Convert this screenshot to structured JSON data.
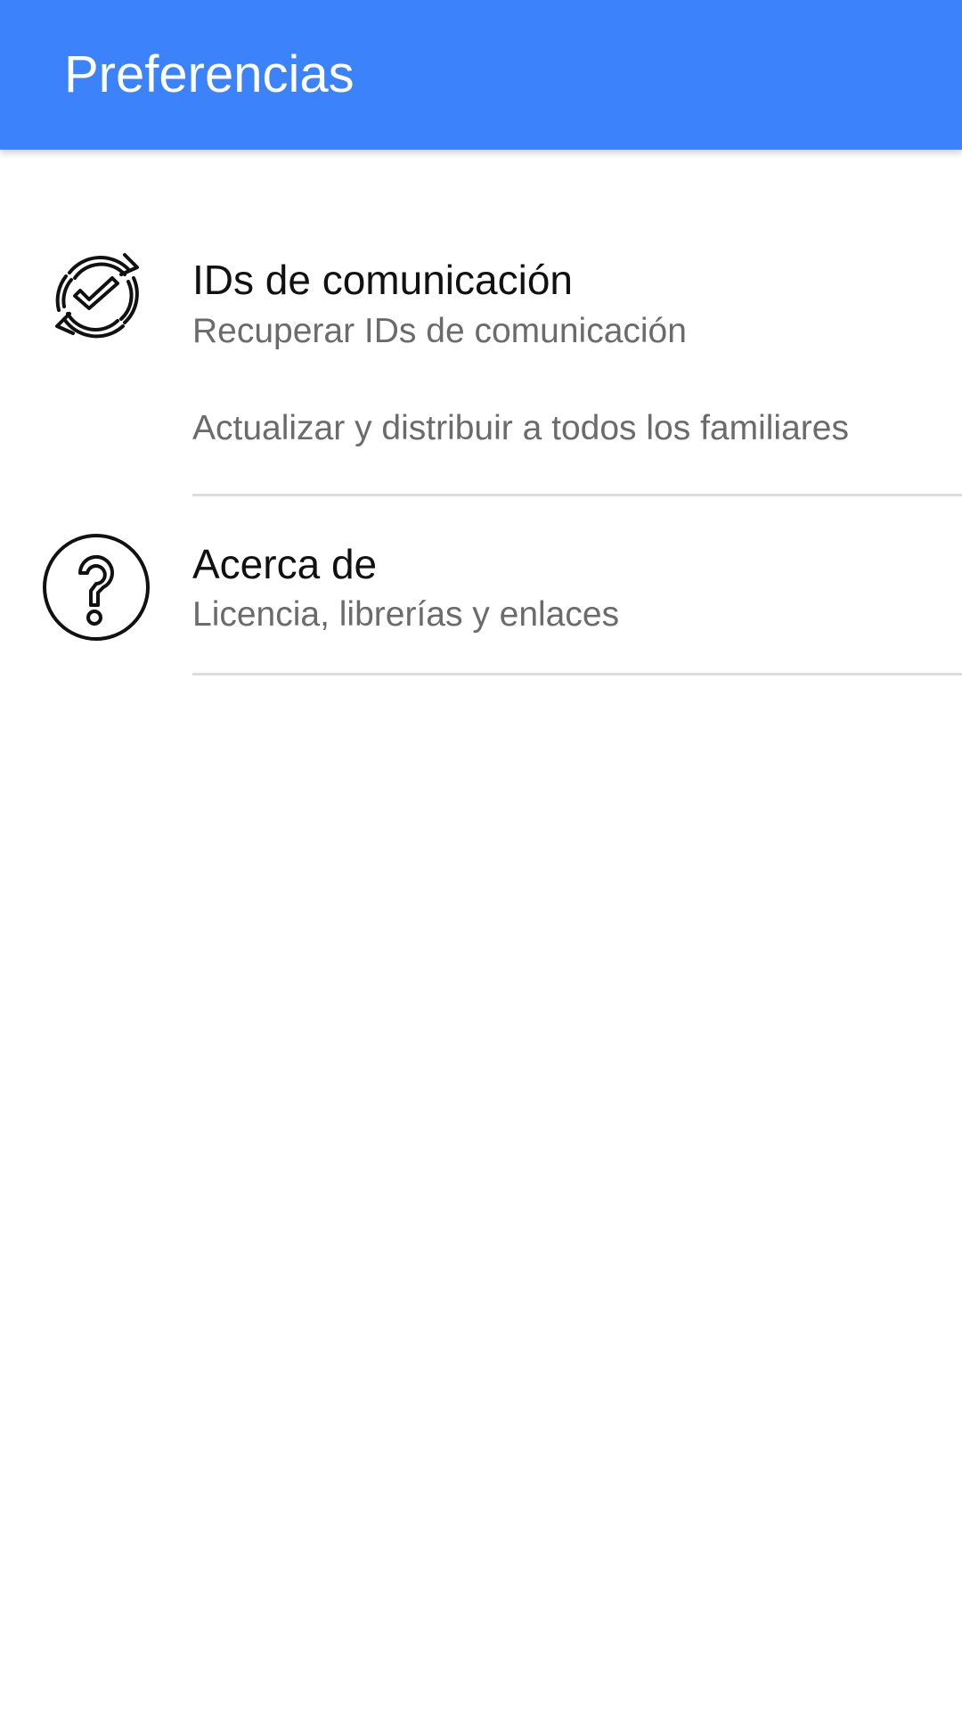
{
  "app_bar": {
    "title": "Preferencias",
    "color": "#3c82fa"
  },
  "preferences": [
    {
      "icon": "sync-check-icon",
      "title": "IDs de comunicación",
      "summary": "Recuperar IDs de comunicación"
    },
    {
      "summary": "Actualizar y distribuir a todos los familiares"
    },
    {
      "icon": "help-circle-icon",
      "title": "Acerca de",
      "summary": "Licencia, librerías y enlaces"
    }
  ]
}
